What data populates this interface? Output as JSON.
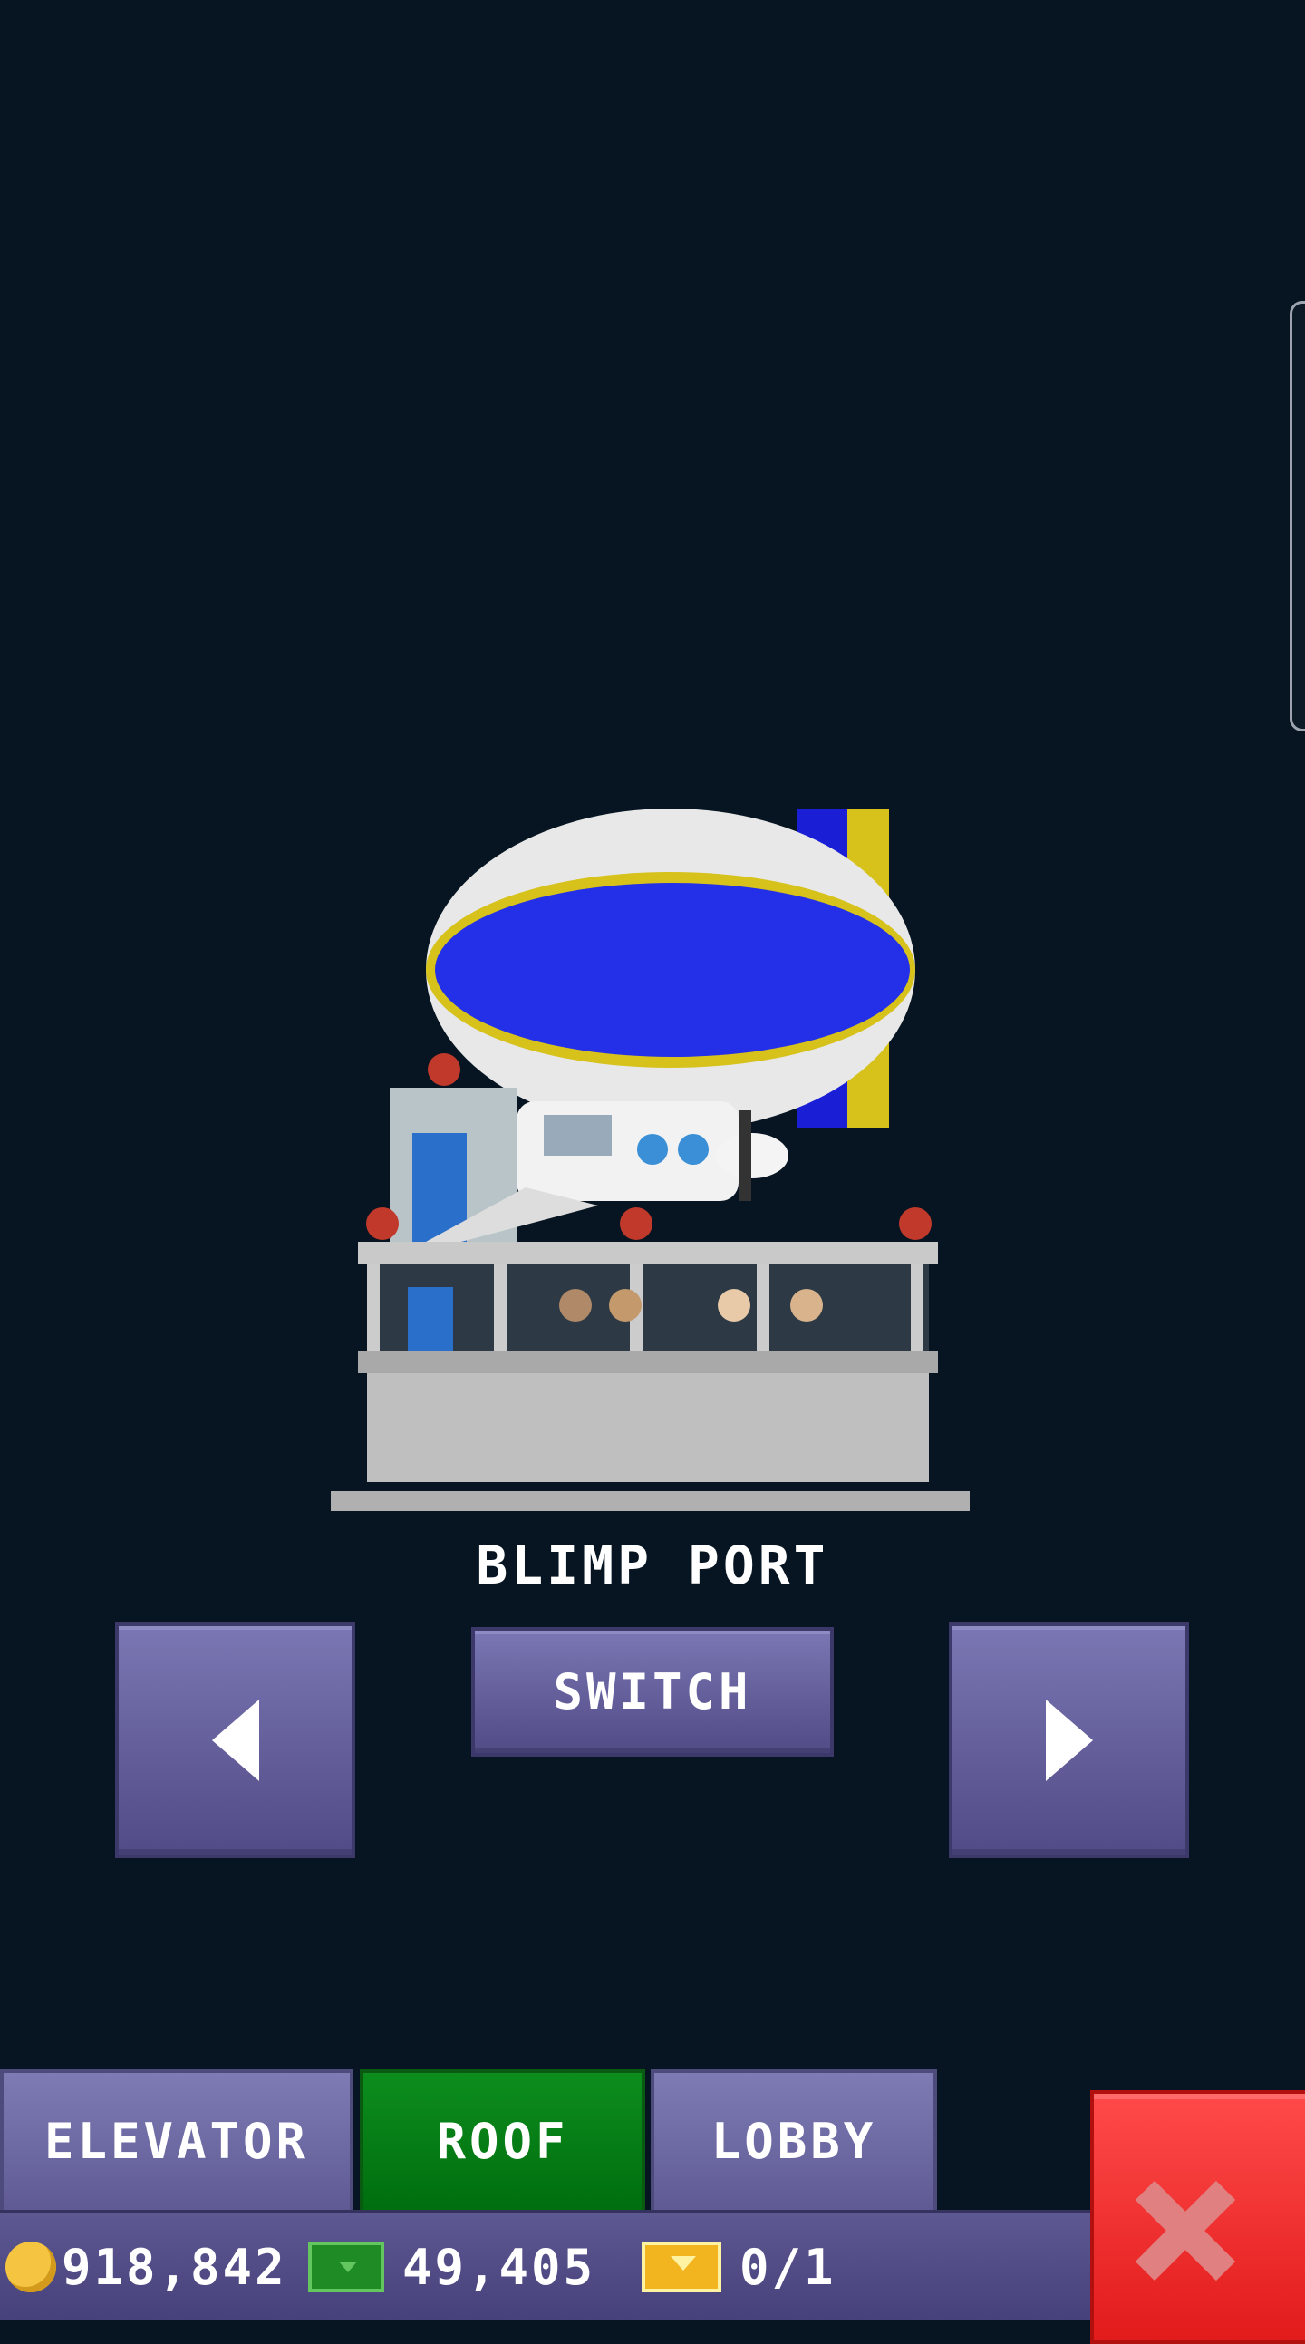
{
  "room": {
    "name": "BLIMP PORT"
  },
  "controls": {
    "switch_label": "SWITCH",
    "prev_icon": "triangle-left-icon",
    "next_icon": "triangle-right-icon"
  },
  "tabs": [
    {
      "label": "ELEVATOR",
      "active": false
    },
    {
      "label": "ROOF",
      "active": true
    },
    {
      "label": "LOBBY",
      "active": false
    }
  ],
  "status": {
    "coins": "918,842",
    "bux": "49,405",
    "tickets": "0/1"
  },
  "colors": {
    "background": "#061521",
    "button": "#6a66a3",
    "active_tab": "#008a12",
    "close": "#e82020"
  }
}
